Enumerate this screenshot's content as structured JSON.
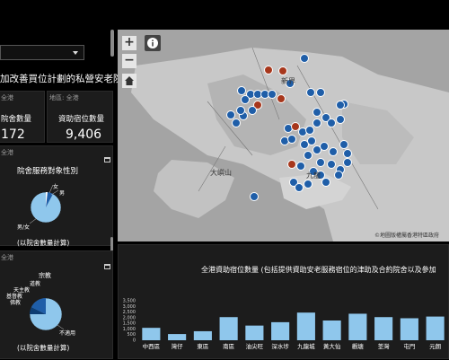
{
  "left": {
    "title": "加改善買位計劃的私營安老院",
    "kpi1": {
      "label_small": "全港",
      "label": "院舍數量",
      "value": "172"
    },
    "kpi2": {
      "label_small": "地區: 全港",
      "label": "資助宿位數量",
      "value": "9,406"
    },
    "gender_card": {
      "small": "全港",
      "title": "院舍服務對象性別",
      "labels": [
        "女",
        "男",
        "男/女"
      ],
      "note": "(以院舍數量計算)"
    },
    "religion_card": {
      "small": "全港",
      "labels": [
        "宗教",
        "天主教",
        "道教",
        "基督教",
        "佛教",
        "不適用"
      ],
      "note": "(以院舍數量計算)"
    }
  },
  "map": {
    "zoom_in": "+",
    "zoom_out": "−",
    "labels": [
      "新界",
      "大嶼山",
      "九龍"
    ],
    "credit": "©地圖版權屬香港特區政府"
  },
  "chart_data": {
    "type": "bar",
    "title": "全港資助宿位數量 (包括提供資助安老服務宿位的津助及合約院舍以及參加",
    "categories": [
      "中西區",
      "灣仔",
      "東區",
      "南區",
      "油尖旺",
      "深水埗",
      "九龍城",
      "黃大仙",
      "觀塘",
      "荃灣",
      "屯門",
      "元朗"
    ],
    "values": [
      1100,
      550,
      800,
      2050,
      1300,
      1600,
      2450,
      1750,
      2350,
      2050,
      1950,
      2100
    ],
    "ylim": [
      0,
      3500
    ],
    "yticks": [
      "3,500",
      "3,000",
      "2,500",
      "2,000",
      "1,500",
      "1,000",
      "500",
      "0"
    ]
  }
}
